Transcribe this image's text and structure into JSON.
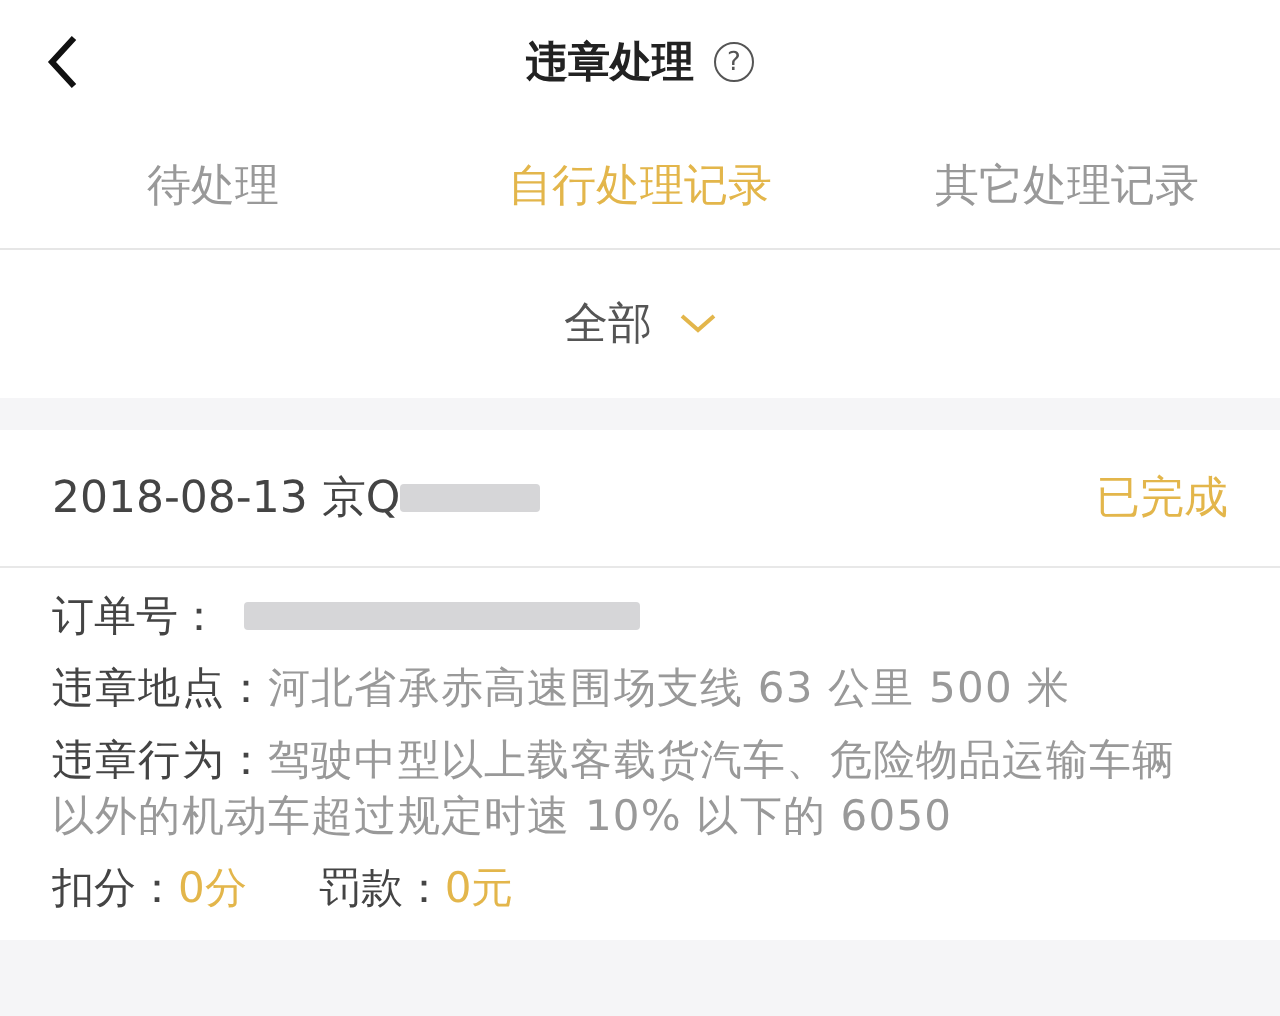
{
  "nav": {
    "title": "违章处理",
    "help": "?"
  },
  "tabs": [
    {
      "label": "待处理",
      "selected": false
    },
    {
      "label": "自行处理记录",
      "selected": true
    },
    {
      "label": "其它处理记录",
      "selected": false
    }
  ],
  "filter": {
    "label": "全部"
  },
  "records": [
    {
      "date": "2018-08-13",
      "plate": "京Q",
      "plate_redacted": true,
      "status": "已完成",
      "order_label": "订单号：",
      "order_redacted": true,
      "fields": [
        {
          "label": "违章地点：",
          "value": "河北省承赤高速围场支线 63 公里 500 米"
        },
        {
          "label": "违章行为：",
          "value": "驾驶中型以上载客载货汽车、危险物品运输车辆以外的机动车超过规定时速 10% 以下的 6050"
        }
      ],
      "points_label": "扣分：",
      "points": "0分",
      "fine_label": "罚款：",
      "fine": "0元"
    }
  ]
}
